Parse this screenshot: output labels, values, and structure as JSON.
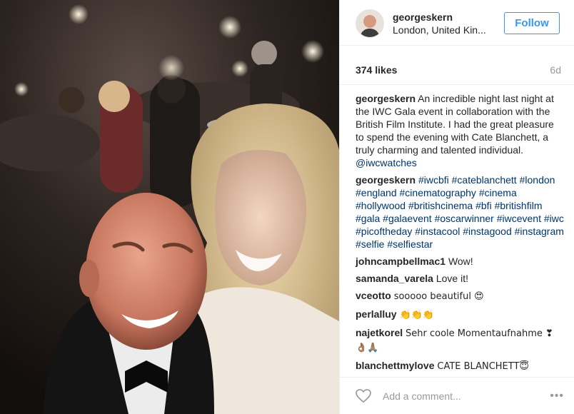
{
  "post": {
    "user": {
      "username": "georgeskern",
      "location": "London, United Kin..."
    },
    "follow_label": "Follow",
    "likes": "374 likes",
    "age": "6d",
    "caption": {
      "author": "georgeskern",
      "text": "An incredible night last night at the IWC Gala event in collaboration with the British Film Institute. I had the great pleasure to spend the evening with Cate Blanchett, a truly charming and talented individual.",
      "mention": "@iwcwatches"
    },
    "hashtag_comment": {
      "author": "georgeskern",
      "tags": [
        "#iwcbfi",
        "#cateblanchett",
        "#london",
        "#england",
        "#cinematography",
        "#cinema",
        "#hollywood",
        "#britishcinema",
        "#bfi",
        "#britishfilm",
        "#gala",
        "#galaevent",
        "#oscarwinner",
        "#iwcevent",
        "#iwc",
        "#picoftheday",
        "#instacool",
        "#instagood",
        "#instagram",
        "#selfie",
        "#selfiestar"
      ]
    },
    "comments": [
      {
        "author": "johncampbellmac1",
        "text": "Wow!"
      },
      {
        "author": "samanda_varela",
        "text": "Love it!"
      },
      {
        "author": "vceotto",
        "text": "sooooo beautiful 😍"
      },
      {
        "author": "perlalluy",
        "text": "👏👏👏"
      },
      {
        "author": "najetkorel",
        "text": "Sehr coole Momentaufnahme ❣👌🏽🙏🏽"
      },
      {
        "author": "blanchettmylove",
        "text": "CATE BLANCHETT😇"
      }
    ],
    "add_comment_placeholder": "Add a comment...",
    "more_label": "•••"
  },
  "icons": {
    "like": "heart-icon",
    "more": "more-options-icon"
  },
  "colors": {
    "link": "#003569",
    "follow": "#3897f0",
    "muted": "#999999"
  }
}
